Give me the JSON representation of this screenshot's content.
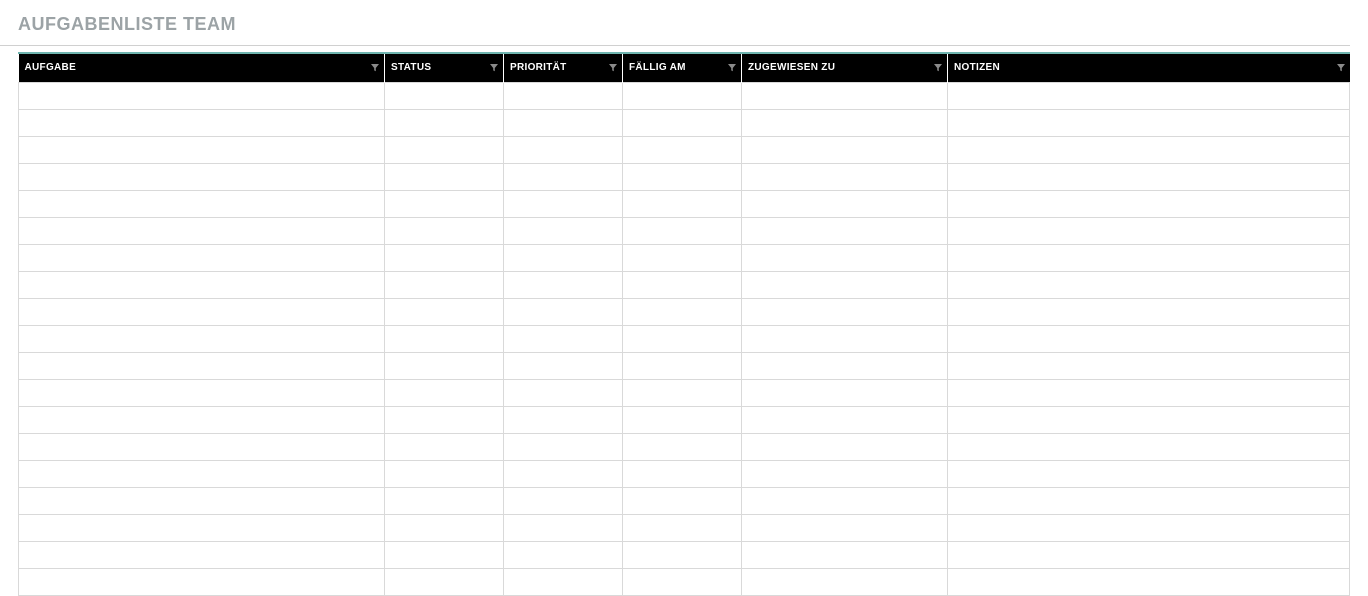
{
  "title": "AUFGABENLISTE TEAM",
  "columns": [
    {
      "label": "AUFGABE"
    },
    {
      "label": "STATUS"
    },
    {
      "label": "PRIORITÄT"
    },
    {
      "label": "FÄLLIG AM"
    },
    {
      "label": "ZUGEWIESEN ZU"
    },
    {
      "label": "NOTIZEN"
    }
  ],
  "rows": [
    [
      "",
      "",
      "",
      "",
      "",
      ""
    ],
    [
      "",
      "",
      "",
      "",
      "",
      ""
    ],
    [
      "",
      "",
      "",
      "",
      "",
      ""
    ],
    [
      "",
      "",
      "",
      "",
      "",
      ""
    ],
    [
      "",
      "",
      "",
      "",
      "",
      ""
    ],
    [
      "",
      "",
      "",
      "",
      "",
      ""
    ],
    [
      "",
      "",
      "",
      "",
      "",
      ""
    ],
    [
      "",
      "",
      "",
      "",
      "",
      ""
    ],
    [
      "",
      "",
      "",
      "",
      "",
      ""
    ],
    [
      "",
      "",
      "",
      "",
      "",
      ""
    ],
    [
      "",
      "",
      "",
      "",
      "",
      ""
    ],
    [
      "",
      "",
      "",
      "",
      "",
      ""
    ],
    [
      "",
      "",
      "",
      "",
      "",
      ""
    ],
    [
      "",
      "",
      "",
      "",
      "",
      ""
    ],
    [
      "",
      "",
      "",
      "",
      "",
      ""
    ],
    [
      "",
      "",
      "",
      "",
      "",
      ""
    ],
    [
      "",
      "",
      "",
      "",
      "",
      ""
    ],
    [
      "",
      "",
      "",
      "",
      "",
      ""
    ],
    [
      "",
      "",
      "",
      "",
      "",
      ""
    ]
  ]
}
